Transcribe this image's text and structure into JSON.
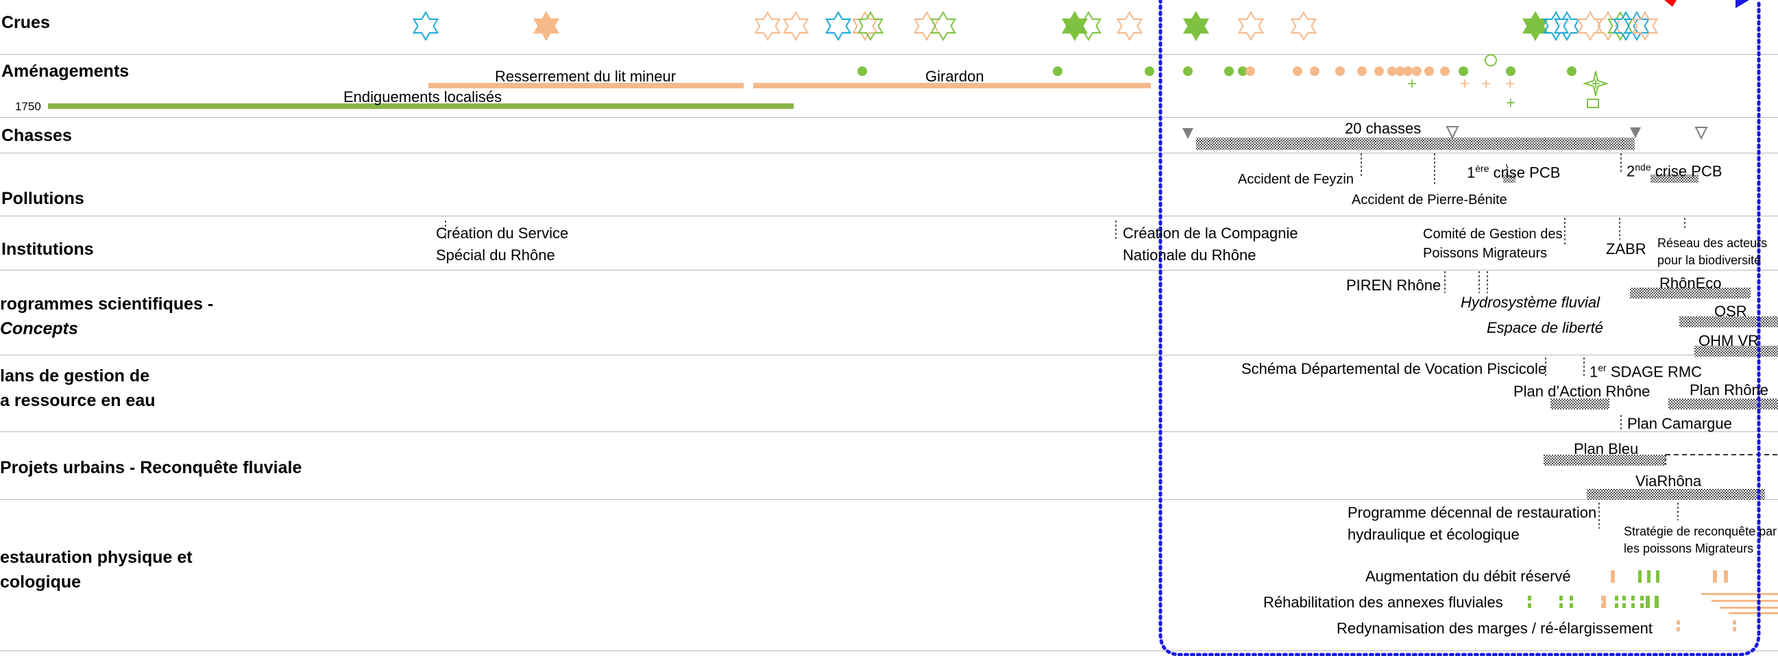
{
  "rows": {
    "crues": "Crues",
    "amenagements": "Aménagements",
    "chasses": "Chasses",
    "pollutions": "Pollutions",
    "institutions": "Institutions",
    "programmes": "rogrammes scientifiques -",
    "programmes_b": "Concepts",
    "plans": "lans de gestion de",
    "plans_b": "a ressource en eau",
    "projets": "Projets urbains - Reconquête fluviale",
    "restauration": "estauration physique et",
    "restauration_b": "cologique"
  },
  "amenagements": {
    "year_start": "1750",
    "resserrement": "Resserrement du lit mineur",
    "girardon": "Girardon",
    "endiguements": "Endiguements localisés"
  },
  "chasses": {
    "label": "20 chasses"
  },
  "pollutions": {
    "feyzin": "Accident de Feyzin",
    "pierre_benite": "Accident de Pierre-Bénite",
    "crise1_a": "1",
    "crise1_sup": "ère",
    "crise1_b": " crise PCB",
    "crise2_a": "2",
    "crise2_sup": "nde",
    "crise2_b": " crise PCB"
  },
  "institutions": {
    "service_1": "Création du Service",
    "service_2": "Spécial du Rhône",
    "cnr_1": "Création de la Compagnie",
    "cnr_2": "Nationale du Rhône",
    "comite_1": "Comité de Gestion des",
    "comite_2": "Poissons Migrateurs",
    "zabr": "ZABR",
    "reseau_1": "Réseau des acteurs",
    "reseau_2": "pour la biodiversité"
  },
  "programmes": {
    "piren": "PIREN Rhône",
    "hydrosysteme": "Hydrosystème fluvial",
    "espace": "Espace de liberté",
    "rhoneco": "RhônEco",
    "osr": "OSR",
    "ohm": "OHM VR"
  },
  "plans": {
    "schema": "Schéma Départemental de Vocation Piscicole",
    "sdage_a": "1",
    "sdage_sup": "er",
    "sdage_b": " SDAGE RMC",
    "plan_action": "Plan d’Action Rhône",
    "plan_rhone": "Plan Rhône",
    "plan_camargue": "Plan Camargue"
  },
  "projets": {
    "plan_bleu": "Plan Bleu",
    "viarhona": "ViaRhôna"
  },
  "restauration": {
    "programme_1": "Programme décennal de restauration",
    "programme_2": "hydraulique et écologique",
    "strategie_1": "Stratégie de reconquête par",
    "strategie_2": "les poissons Migrateurs",
    "debit": "Augmentation du débit réservé",
    "annexes": "Réhabilitation des annexes fluviales",
    "marges": "Redynamisation des marges / ré-élargissement"
  },
  "colors": {
    "cyan": "#1ea9d6",
    "orange": "#f5b98a",
    "green": "#7fc241",
    "olive_green": "#8ab34a",
    "blue_dotted": "#1a1ae0",
    "grey": "#808080",
    "red": "#ff0000"
  }
}
